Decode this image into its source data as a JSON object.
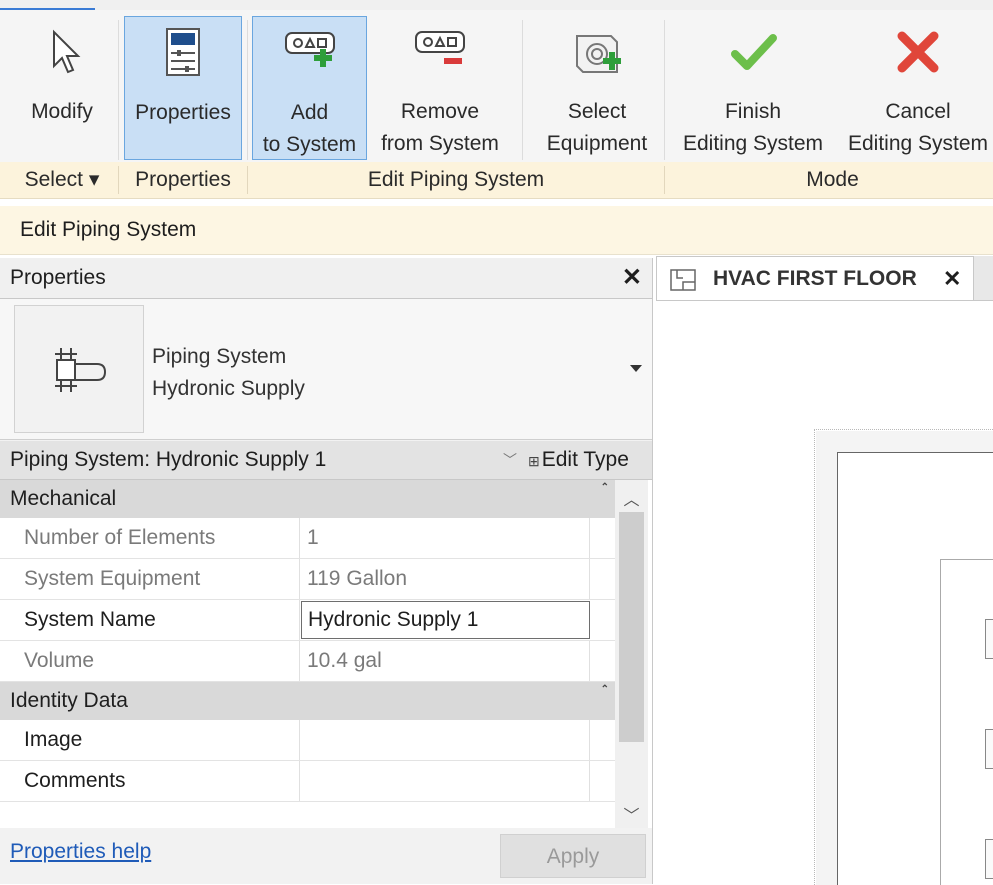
{
  "ribbon": {
    "buttons": [
      {
        "label1": "Modify",
        "label2": "",
        "icon": "cursor-arrow-icon"
      },
      {
        "label1": "Properties",
        "label2": "",
        "icon": "properties-icon"
      },
      {
        "label1": "Add",
        "label2": "to System",
        "icon": "add-to-system-icon"
      },
      {
        "label1": "Remove",
        "label2": "from System",
        "icon": "remove-from-system-icon"
      },
      {
        "label1": "Select",
        "label2": "Equipment",
        "icon": "select-equipment-icon"
      },
      {
        "label1": "Finish",
        "label2": "Editing System",
        "icon": "checkmark-icon"
      },
      {
        "label1": "Cancel",
        "label2": "Editing System",
        "icon": "cancel-x-icon"
      }
    ],
    "panels": {
      "select": "Select",
      "properties": "Properties",
      "edit_piping": "Edit Piping System",
      "mode": "Mode"
    },
    "colors": {
      "finish": "#6cbf4a",
      "cancel": "#e0463a",
      "add": "#2e9e3a",
      "remove": "#d93a3a"
    }
  },
  "context_bar": {
    "label": "Edit Piping System"
  },
  "properties": {
    "title": "Properties",
    "type_family": "Piping System",
    "type_name": "Hydronic Supply",
    "instance_label": "Piping System: Hydronic Supply 1",
    "edit_type": "Edit Type",
    "groups": [
      {
        "name": "Mechanical",
        "rows": [
          {
            "key": "Number of Elements",
            "value": "1"
          },
          {
            "key": "System Equipment",
            "value": "119 Gallon"
          },
          {
            "key": "System Name",
            "value": "Hydronic Supply 1"
          },
          {
            "key": "Volume",
            "value": "10.4 gal"
          }
        ]
      },
      {
        "name": "Identity Data",
        "rows": [
          {
            "key": "Image",
            "value": ""
          },
          {
            "key": "Comments",
            "value": ""
          }
        ]
      }
    ],
    "help_link": "Properties help",
    "apply": "Apply"
  },
  "view": {
    "tab_title": "HVAC FIRST FLOOR"
  }
}
